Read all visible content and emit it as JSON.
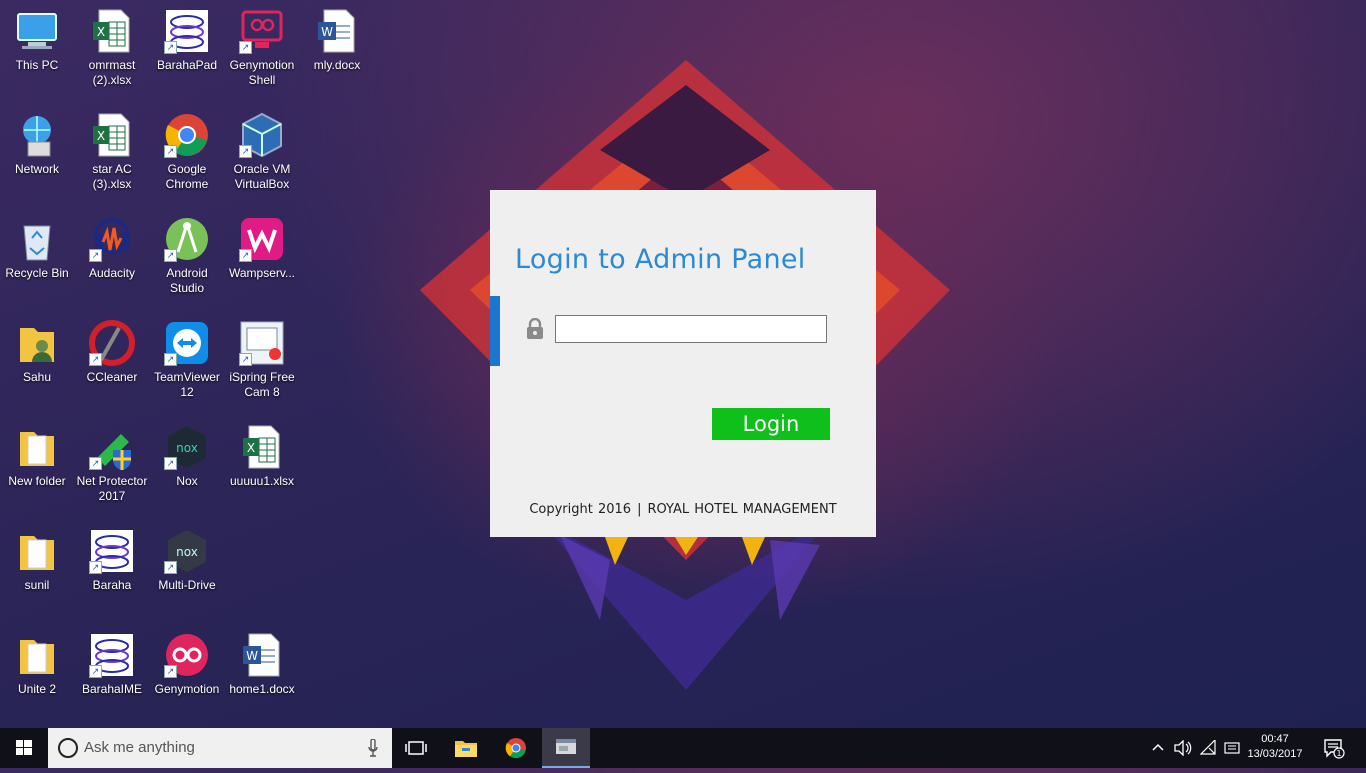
{
  "desktop": {
    "icons": [
      {
        "label": "This PC",
        "icon": "this-pc-icon"
      },
      {
        "label": "omrmast (2).xlsx",
        "icon": "excel-file-icon"
      },
      {
        "label": "BarahaPad",
        "icon": "baraha-icon"
      },
      {
        "label": "Genymotion Shell",
        "icon": "genymotion-shell-icon"
      },
      {
        "label": "mly.docx",
        "icon": "word-file-icon"
      },
      {
        "label": "Network",
        "icon": "network-icon"
      },
      {
        "label": "star AC (3).xlsx",
        "icon": "excel-file-icon"
      },
      {
        "label": "Google Chrome",
        "icon": "chrome-icon"
      },
      {
        "label": "Oracle VM VirtualBox",
        "icon": "virtualbox-icon"
      },
      {
        "label": "Recycle Bin",
        "icon": "recycle-bin-icon"
      },
      {
        "label": "Audacity",
        "icon": "audacity-icon"
      },
      {
        "label": "Android Studio",
        "icon": "android-studio-icon"
      },
      {
        "label": "Wampserv...",
        "icon": "wampserver-icon"
      },
      {
        "label": "Sahu",
        "icon": "user-folder-icon"
      },
      {
        "label": "CCleaner",
        "icon": "ccleaner-icon"
      },
      {
        "label": "TeamViewer 12",
        "icon": "teamviewer-icon"
      },
      {
        "label": "iSpring Free Cam 8",
        "icon": "ispring-icon"
      },
      {
        "label": "New folder",
        "icon": "folder-icon"
      },
      {
        "label": "Net Protector 2017",
        "icon": "net-protector-icon"
      },
      {
        "label": "Nox",
        "icon": "nox-icon"
      },
      {
        "label": "uuuuu1.xlsx",
        "icon": "excel-file-icon"
      },
      {
        "label": "sunil",
        "icon": "folder-icon"
      },
      {
        "label": "Baraha",
        "icon": "baraha-icon"
      },
      {
        "label": "Multi-Drive",
        "icon": "nox-multi-drive-icon"
      },
      {
        "label": "Unite 2",
        "icon": "folder-icon"
      },
      {
        "label": "BarahaIME",
        "icon": "baraha-icon"
      },
      {
        "label": "Genymotion",
        "icon": "genymotion-icon"
      },
      {
        "label": "home1.docx",
        "icon": "word-file-icon"
      }
    ]
  },
  "login": {
    "title": "Login to Admin Panel",
    "password_value": "",
    "button_label": "Login",
    "copyright_left": "Copyright 2016",
    "copyright_sep": "|",
    "copyright_right": "ROYAL HOTEL MANAGEMENT"
  },
  "taskbar": {
    "search_placeholder": "Ask me anything",
    "time": "00:47",
    "date": "13/03/2017",
    "notification_count": "1"
  },
  "colors": {
    "accent_blue": "#1b76d1",
    "title_blue": "#2a8ad4",
    "login_green": "#10c01a"
  }
}
